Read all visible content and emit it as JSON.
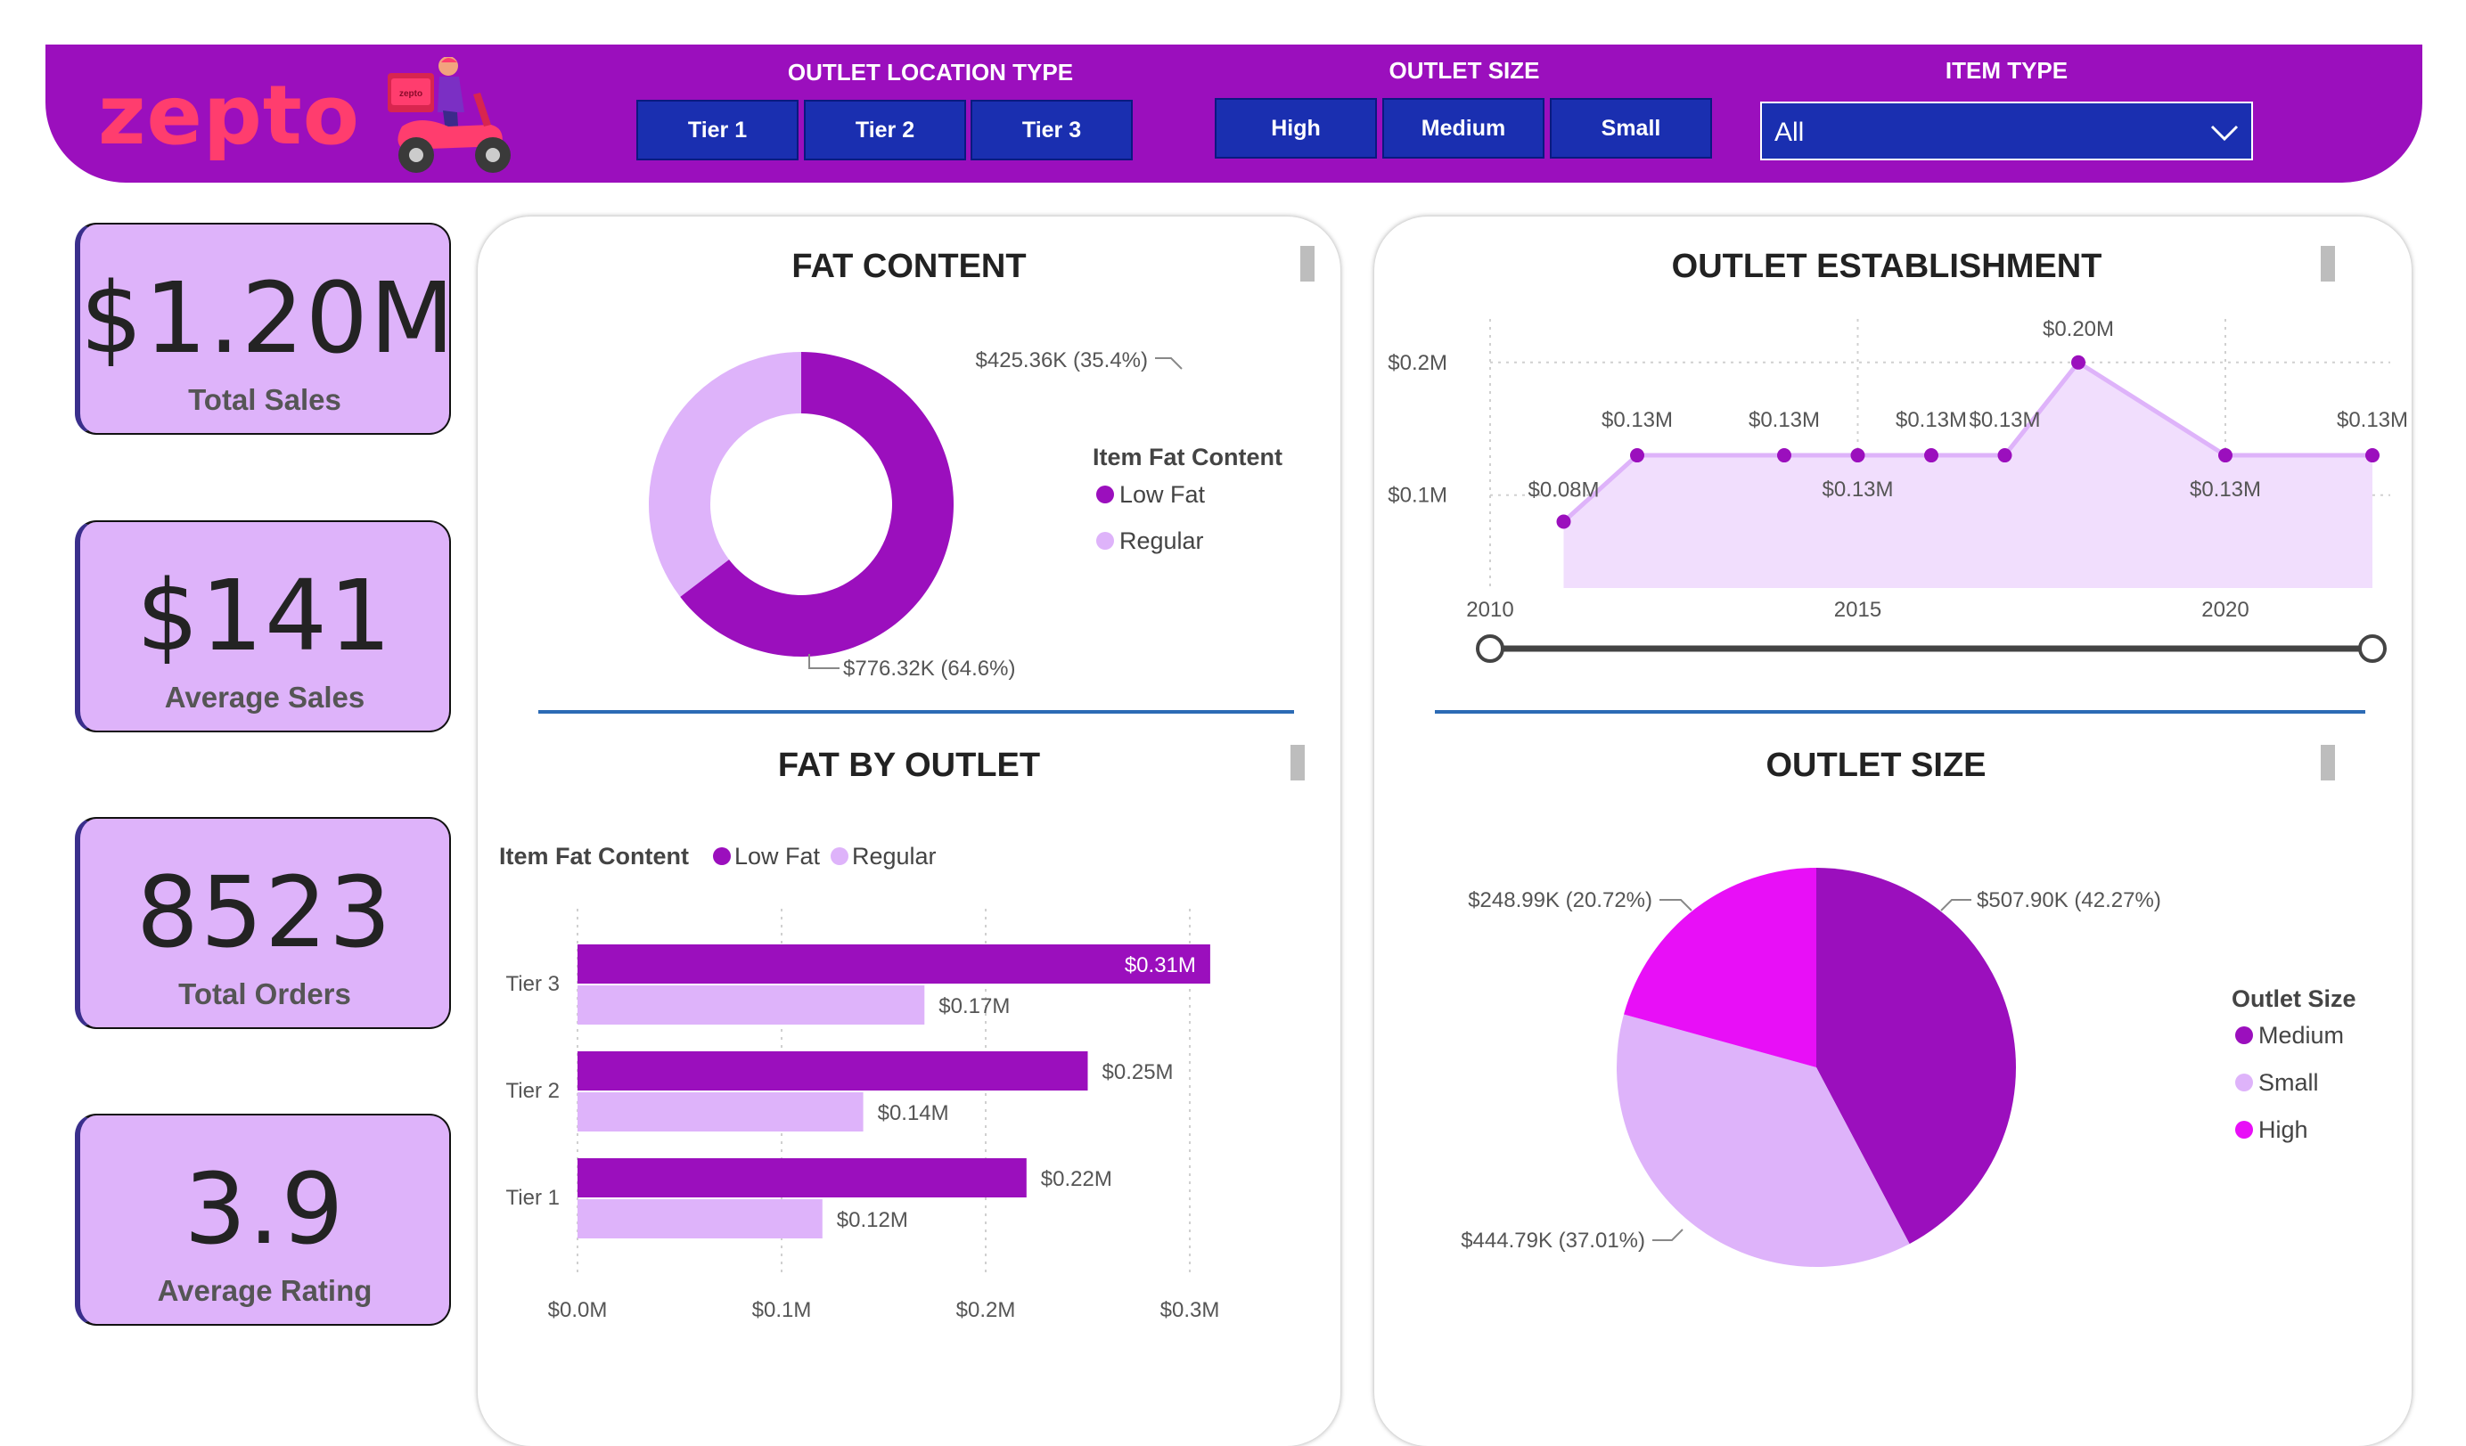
{
  "header": {
    "logo": "zepto",
    "scooter_badge": "zepto",
    "outlet_location_type": {
      "title": "OUTLET LOCATION TYPE",
      "options": [
        "Tier 1",
        "Tier 2",
        "Tier 3"
      ]
    },
    "outlet_size": {
      "title": "OUTLET SIZE",
      "options": [
        "High",
        "Medium",
        "Small"
      ]
    },
    "item_type": {
      "title": "ITEM TYPE",
      "selected": "All"
    }
  },
  "kpis": [
    {
      "value": "$1.20M",
      "label": "Total Sales"
    },
    {
      "value": "$141",
      "label": "Average Sales"
    },
    {
      "value": "8523",
      "label": "Total Orders"
    },
    {
      "value": "3.9",
      "label": "Average Rating"
    }
  ],
  "colors": {
    "header_bg": "#9b0fbd",
    "slicer_btn": "#1a2fb0",
    "kpi_bg": "#deb3fa",
    "low_fat": "#9b0fbd",
    "regular": "#deb3fa",
    "medium": "#9b0fbd",
    "small": "#deb3fa",
    "high": "#e80ff7",
    "logo": "#ff3d6e"
  },
  "icons": [
    "scooter-icon",
    "chevron-down-icon"
  ],
  "chart_data": [
    {
      "type": "pie",
      "variant": "donut",
      "title": "FAT CONTENT",
      "legend_title": "Item Fat Content",
      "legend_position": "right",
      "slices": [
        {
          "name": "Low Fat",
          "value": 776.32,
          "label": "$776.32K (64.6%)"
        },
        {
          "name": "Regular",
          "value": 425.36,
          "label": "$425.36K (35.4%)"
        }
      ]
    },
    {
      "type": "area",
      "title": "OUTLET ESTABLISHMENT",
      "x": [
        2011,
        2012,
        2014,
        2015,
        2016,
        2017,
        2018,
        2020,
        2022
      ],
      "values": [
        0.08,
        0.13,
        0.13,
        0.13,
        0.13,
        0.13,
        0.2,
        0.13,
        0.13
      ],
      "point_labels": [
        "$0.08M",
        "$0.13M",
        "$0.13M",
        "$0.13M",
        "$0.13M",
        "$0.13M",
        "$0.20M",
        "$0.13M",
        "$0.13M"
      ],
      "xticks": [
        "2010",
        "2015",
        "2020"
      ],
      "yticks": [
        "$0.1M",
        "$0.2M"
      ],
      "xlim": [
        2010,
        2022
      ],
      "ylim": [
        0.03,
        0.22
      ],
      "grid": true
    },
    {
      "type": "bar",
      "orientation": "horizontal",
      "title": "FAT BY OUTLET",
      "legend_title": "Item Fat Content",
      "legend_position": "top-left",
      "categories": [
        "Tier 3",
        "Tier 2",
        "Tier 1"
      ],
      "series": [
        {
          "name": "Low Fat",
          "values": [
            0.31,
            0.25,
            0.22
          ],
          "labels": [
            "$0.31M",
            "$0.25M",
            "$0.22M"
          ]
        },
        {
          "name": "Regular",
          "values": [
            0.17,
            0.14,
            0.12
          ],
          "labels": [
            "$0.17M",
            "$0.14M",
            "$0.12M"
          ]
        }
      ],
      "xticks": [
        "$0.0M",
        "$0.1M",
        "$0.2M",
        "$0.3M"
      ],
      "xlim": [
        0,
        0.3
      ],
      "grid": true
    },
    {
      "type": "pie",
      "title": "OUTLET SIZE",
      "legend_title": "Outlet Size",
      "legend_position": "right",
      "slices": [
        {
          "name": "Medium",
          "value": 507.9,
          "label": "$507.90K (42.27%)"
        },
        {
          "name": "Small",
          "value": 444.79,
          "label": "$444.79K (37.01%)"
        },
        {
          "name": "High",
          "value": 248.99,
          "label": "$248.99K (20.72%)"
        }
      ]
    }
  ]
}
